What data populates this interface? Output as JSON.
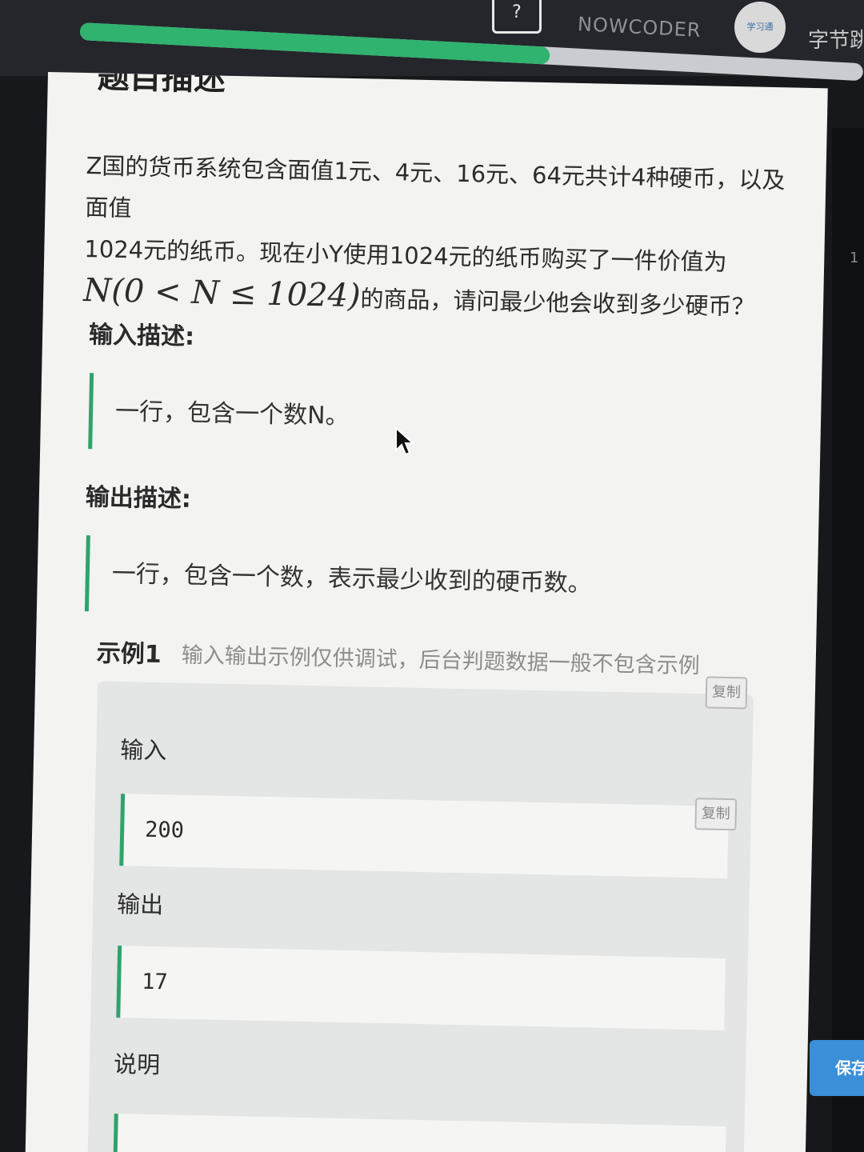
{
  "header": {
    "logo_glyph": "?",
    "logo_text": "NOWCODER",
    "avatar_text": "学习通",
    "user_text": "字节跳",
    "progress_percent": 60,
    "accent_color": "#2fb36f"
  },
  "problem": {
    "heading": "题目描述",
    "desc_line1": "Z国的货币系统包含面值1元、4元、16元、64元共计4种硬币，以及面值",
    "desc_line2": "1024元的纸币。现在小Y使用1024元的纸币购买了一件价值为",
    "desc_math": "N(0 < N ≤ 1024)",
    "desc_line3": "的商品，请问最少他会收到多少硬币？",
    "input_title": "输入描述:",
    "input_text": "一行，包含一个数N。",
    "output_title": "输出描述:",
    "output_text": "一行，包含一个数，表示最少收到的硬币数。"
  },
  "example": {
    "title": "示例1",
    "note": "输入输出示例仅供调试，后台判题数据一般不包含示例",
    "copy_label": "复制",
    "input_label": "输入",
    "input_value": "200",
    "output_label": "输出",
    "output_value": "17",
    "explain_label": "说明"
  },
  "sidebar": {
    "line_number": "1",
    "save_label": "保存"
  }
}
